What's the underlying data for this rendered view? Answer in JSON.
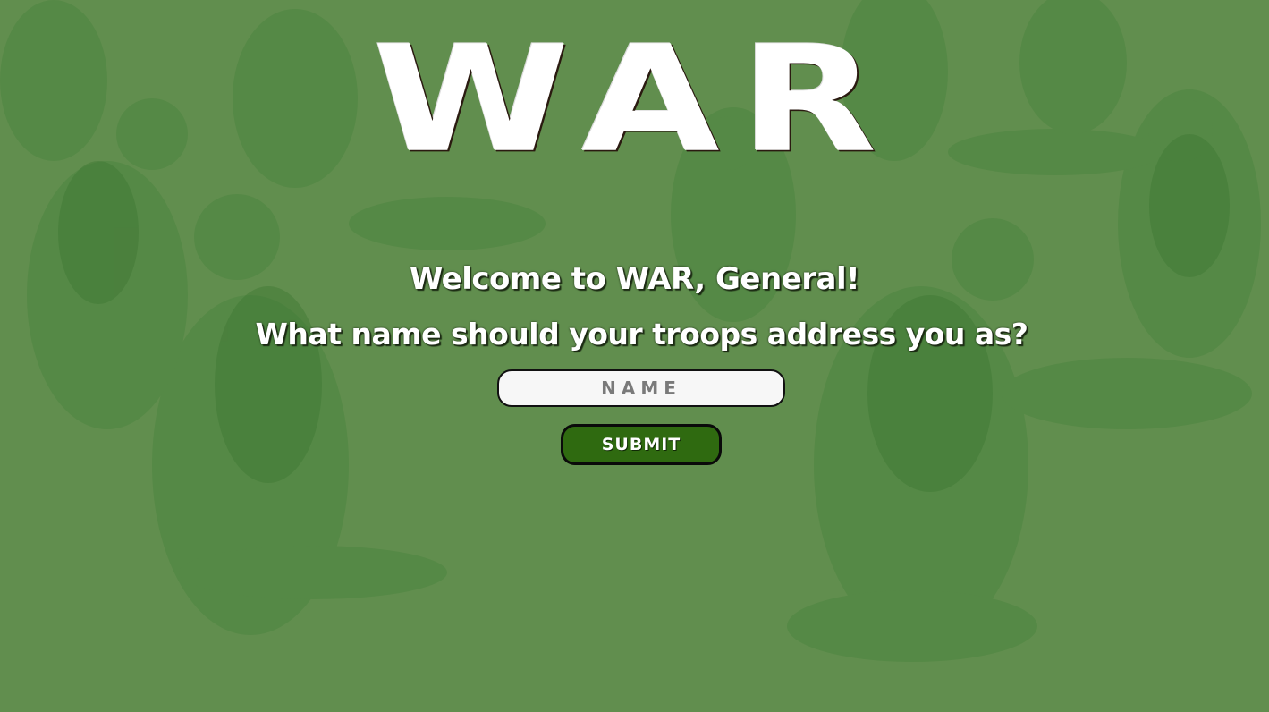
{
  "header": {
    "title": "WAR"
  },
  "main": {
    "welcome_text": "Welcome to WAR, General!",
    "question_text": "What name should your troops address you as?",
    "name_input": {
      "value": "",
      "placeholder": "NAME"
    },
    "submit_label": "SUBMIT"
  },
  "background": {
    "description_icon": "toy-soldiers-image",
    "tint_color": "#618e4e"
  },
  "colors": {
    "button_bg": "#2f6a10",
    "text": "#ffffff"
  }
}
